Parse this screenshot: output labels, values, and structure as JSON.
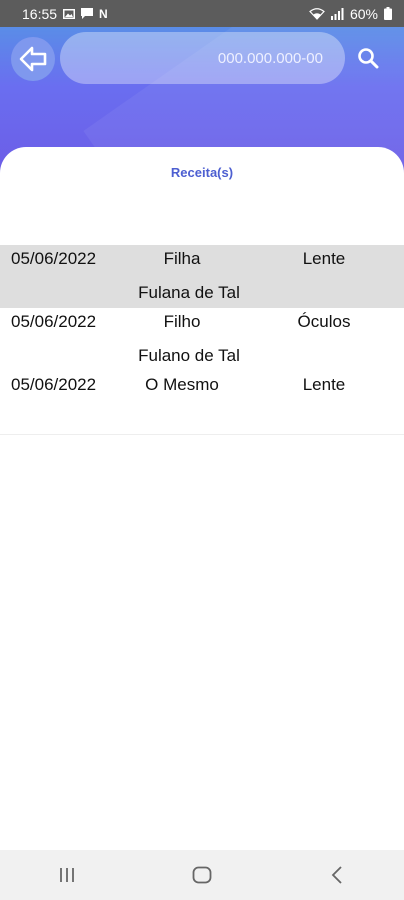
{
  "status_bar": {
    "time": "16:55",
    "notification_icons": [
      "image-icon",
      "message-icon",
      "n-icon"
    ],
    "n_glyph": "N",
    "battery": "60%",
    "system_icons": [
      "wifi-icon",
      "signal-icon",
      "battery-icon"
    ]
  },
  "header": {
    "search_value": "000.000.000-00",
    "colors": {
      "gradient_top": "#5a8de7",
      "gradient_bottom": "#6c5ce6"
    }
  },
  "main": {
    "section_title": "Receita(s)",
    "accent_color": "#4d5fd1",
    "rows": [
      {
        "date": "05/06/2022",
        "relation": "Filha",
        "kind": "Lente",
        "person": "Fulana de Tal"
      },
      {
        "date": "05/06/2022",
        "relation": "Filho",
        "kind": "Óculos",
        "person": "Fulano de Tal"
      },
      {
        "date": "05/06/2022",
        "relation": "O Mesmo",
        "kind": "Lente",
        "person": ""
      }
    ]
  },
  "nav_bar": {
    "buttons": [
      "recent-apps-icon",
      "home-icon",
      "back-nav-icon"
    ]
  }
}
